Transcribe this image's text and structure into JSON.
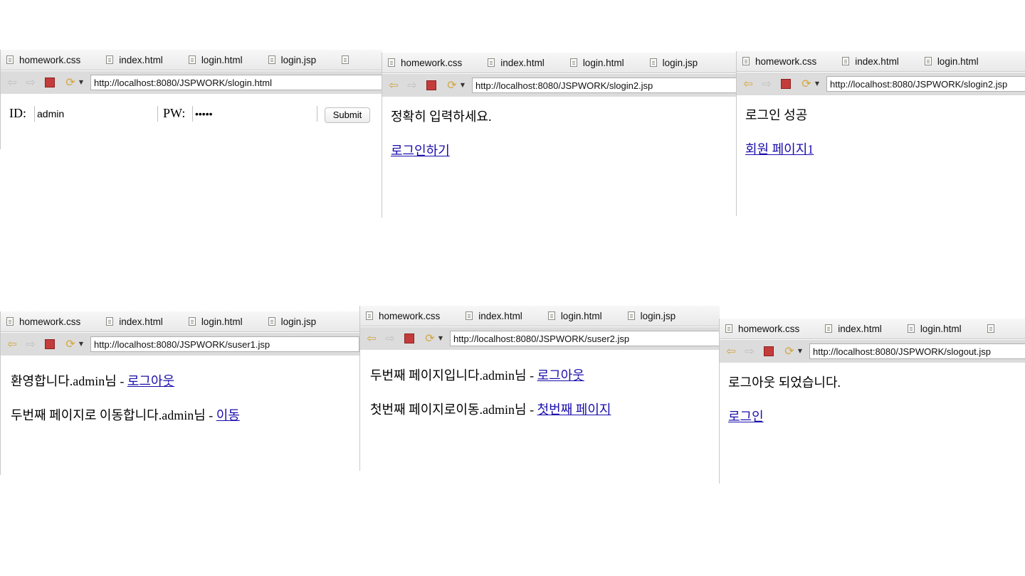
{
  "tabs_set_a": [
    "homework.css",
    "index.html",
    "login.html",
    "login.jsp"
  ],
  "colors": {
    "link": "#1a0dab",
    "stop": "#c43b3b",
    "arrow": "#d4a640"
  },
  "panels": {
    "p1": {
      "url": "http://localhost:8080/JSPWORK/slogin.html",
      "id_label": "ID:",
      "id_value": "admin",
      "pw_label": "PW:",
      "pw_value": "•••••",
      "submit_label": "Submit"
    },
    "p2": {
      "url": "http://localhost:8080/JSPWORK/slogin2.jsp",
      "message": "정확히 입력하세요.",
      "link": "로그인하기"
    },
    "p3": {
      "url": "http://localhost:8080/JSPWORK/slogin2.jsp",
      "message": "로그인 성공",
      "link": "회원 페이지1"
    },
    "p4": {
      "url": "http://localhost:8080/JSPWORK/suser1.jsp",
      "line1_text": "환영합니다.admin님 - ",
      "line1_link": "로그아웃",
      "line2_text": "두번째 페이지로 이동합니다.admin님 - ",
      "line2_link": "이동"
    },
    "p5": {
      "url": "http://localhost:8080/JSPWORK/suser2.jsp",
      "line1_text": "두번째 페이지입니다.admin님 - ",
      "line1_link": "로그아웃",
      "line2_text": "첫번째 페이지로이동.admin님 - ",
      "line2_link": "첫번째 페이지"
    },
    "p6": {
      "url": "http://localhost:8080/JSPWORK/slogout.jsp",
      "message": "로그아웃 되었습니다.",
      "link": "로그인"
    }
  }
}
